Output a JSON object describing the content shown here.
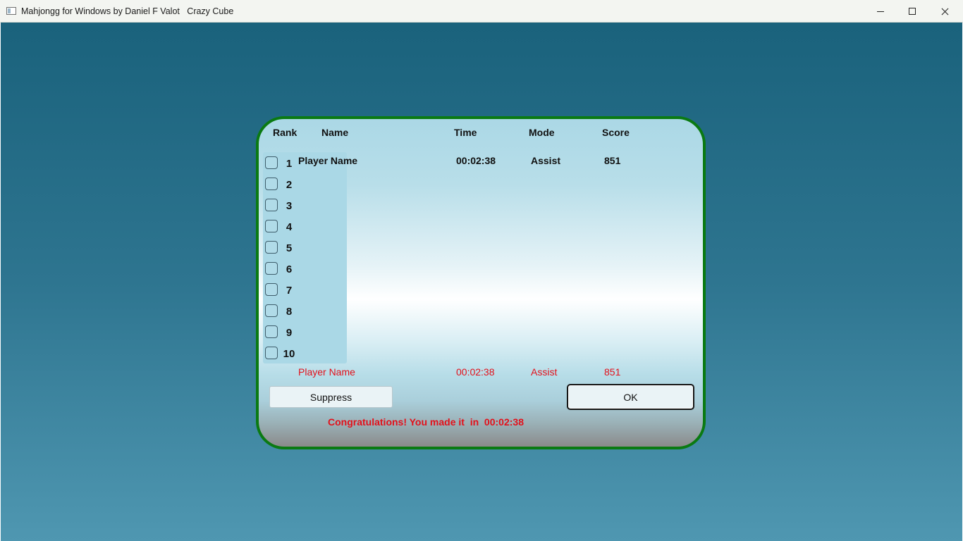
{
  "window": {
    "title": "Mahjongg for Windows by Daniel F Valot   Crazy Cube"
  },
  "headers": {
    "rank": "Rank",
    "name": "Name",
    "time": "Time",
    "mode": "Mode",
    "score": "Score"
  },
  "ranks": [
    "1",
    "2",
    "3",
    "4",
    "5",
    "6",
    "7",
    "8",
    "9",
    "10"
  ],
  "entries": [
    {
      "name": "Player Name",
      "time": "00:02:38",
      "mode": "Assist",
      "score": "851"
    }
  ],
  "current": {
    "name": "Player Name",
    "time": "00:02:38",
    "mode": "Assist",
    "score": "851"
  },
  "buttons": {
    "suppress": "Suppress",
    "ok": "OK"
  },
  "message": "Congratulations! You made it  in  00:02:38",
  "colors": {
    "frame": "#0a7a12",
    "highlight": "#e3101a"
  }
}
